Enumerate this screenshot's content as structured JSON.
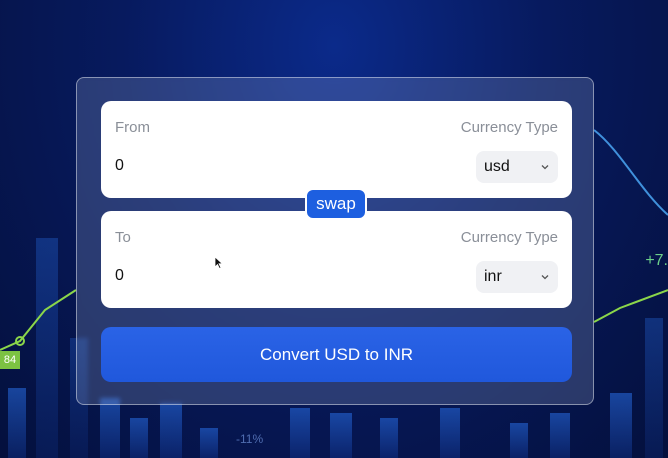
{
  "background": {
    "label_plus": "+7.",
    "label_84": "84",
    "label_minus11": "-11%"
  },
  "from": {
    "label": "From",
    "currency_type_label": "Currency Type",
    "amount": "0",
    "currency": "usd"
  },
  "to": {
    "label": "To",
    "currency_type_label": "Currency Type",
    "amount": "0",
    "currency": "inr"
  },
  "swap_label": "swap",
  "convert_label": "Convert USD to INR",
  "colors": {
    "accent": "#1d5fe0",
    "panel": "#ffffff",
    "muted_text": "#8a8f98"
  },
  "icons": {
    "select_chevron": "chevron-down-icon",
    "cursor": "mouse-pointer-icon"
  }
}
